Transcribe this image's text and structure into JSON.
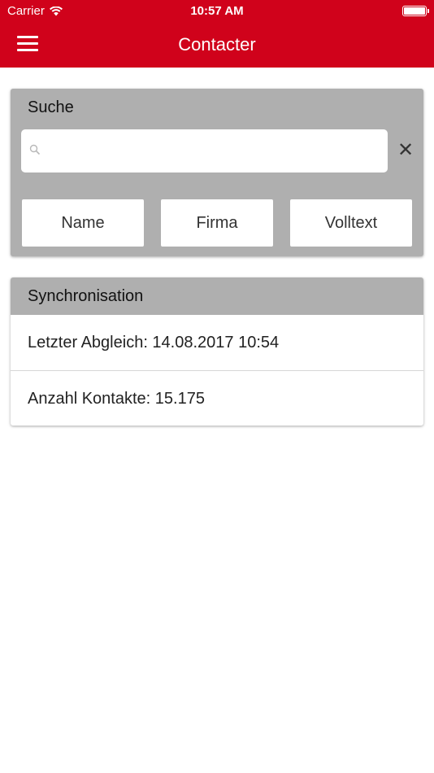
{
  "status_bar": {
    "carrier": "Carrier",
    "time": "10:57 AM"
  },
  "header": {
    "title": "Contacter"
  },
  "search": {
    "title": "Suche",
    "query": "",
    "filters": [
      "Name",
      "Firma",
      "Volltext"
    ]
  },
  "sync": {
    "title": "Synchronisation",
    "rows": [
      "Letzter Abgleich: 14.08.2017 10:54",
      "Anzahl Kontakte: 15.175"
    ]
  },
  "colors": {
    "brand_red": "#d0021b",
    "card_grey": "#afafaf",
    "background": "#ffffff"
  },
  "icons": [
    "wifi-icon",
    "battery-icon",
    "menu-icon",
    "search-icon",
    "close-icon"
  ]
}
